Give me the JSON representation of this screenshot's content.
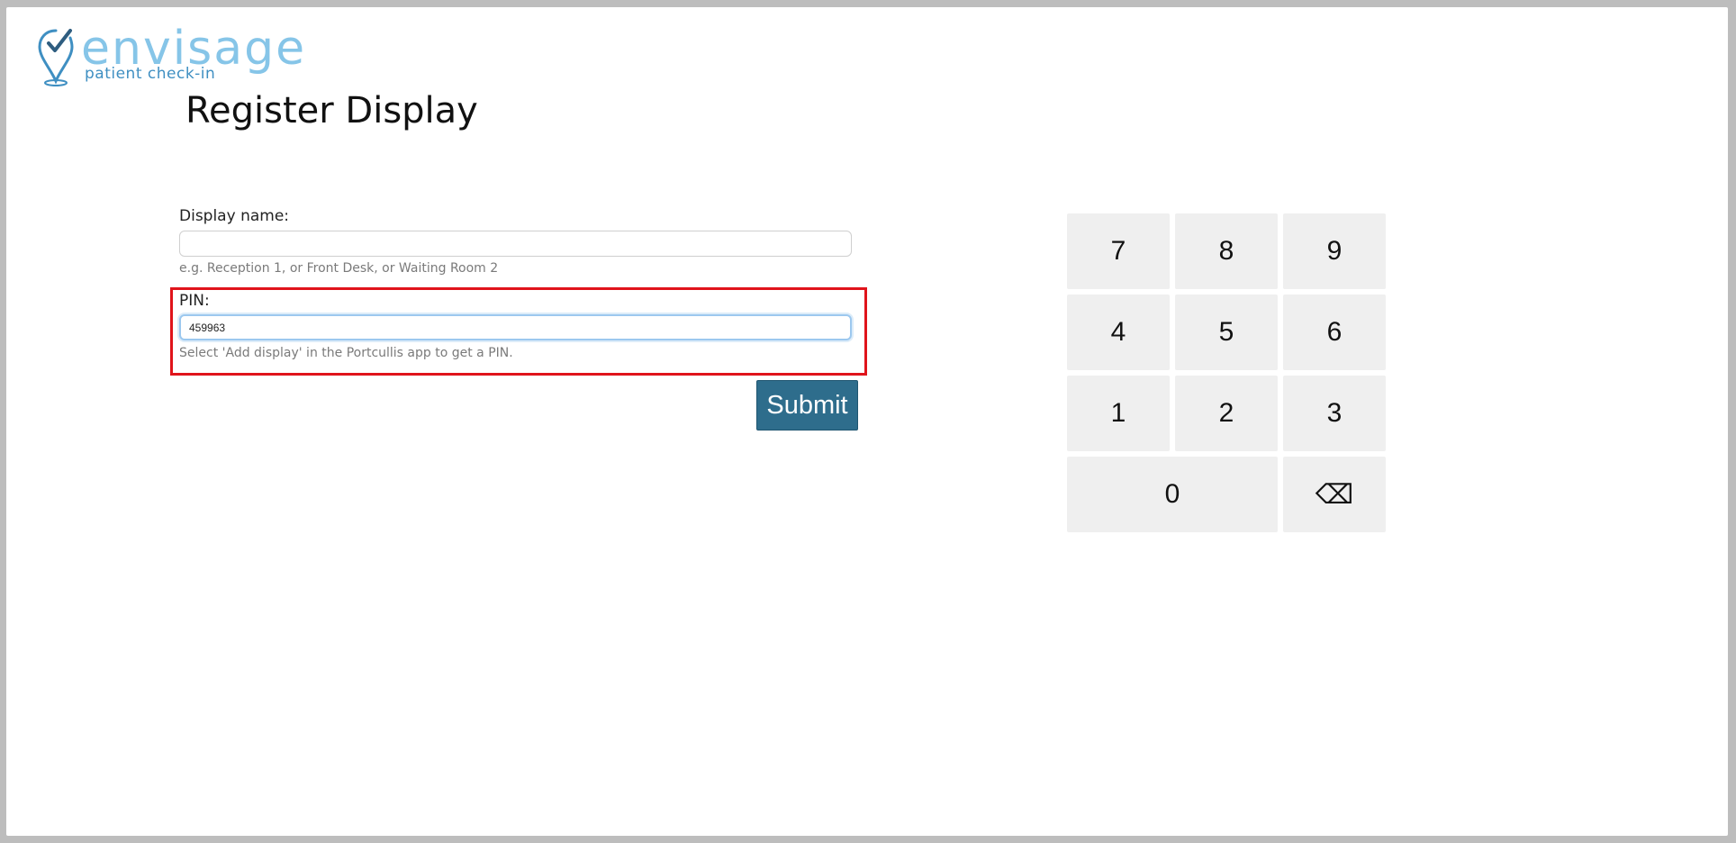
{
  "logo": {
    "word": "envisage",
    "subtitle": "patient check-in",
    "brand_color": "#86c5e8",
    "accent_color": "#2e6d8c"
  },
  "page": {
    "title": "Register Display"
  },
  "form": {
    "display_name": {
      "label": "Display name:",
      "value": "",
      "hint": "e.g. Reception 1, or Front Desk, or Waiting Room 2"
    },
    "pin": {
      "label": "PIN:",
      "value": "459963",
      "hint": "Select 'Add display' in the Portcullis app to get a PIN."
    },
    "submit_label": "Submit"
  },
  "keypad": {
    "keys": [
      "7",
      "8",
      "9",
      "4",
      "5",
      "6",
      "1",
      "2",
      "3",
      "0"
    ],
    "backspace_symbol": "⌫",
    "backspace_icon": "backspace-icon"
  },
  "colors": {
    "highlight": "#e0141b",
    "submit_bg": "#2e6d8c",
    "key_bg": "#efefef"
  }
}
